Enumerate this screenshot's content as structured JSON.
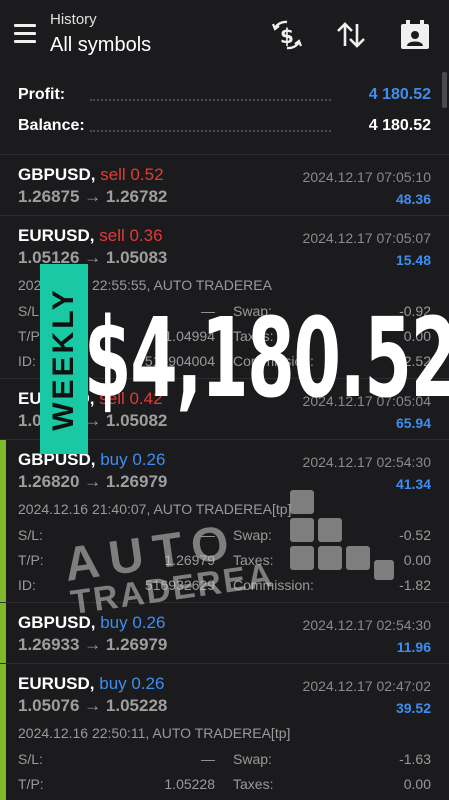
{
  "header": {
    "subtitle": "History",
    "title": "All symbols"
  },
  "summary": [
    {
      "label": "Profit:",
      "value": "4 180.52",
      "color": "#3d8ef0"
    },
    {
      "label": "Balance:",
      "value": "4 180.52",
      "color": "#ffffff"
    }
  ],
  "deals": [
    {
      "symbol": "GBPUSD,",
      "side": "sell 0.52",
      "prices": "1.26875 → 1.26782",
      "time": "2024.12.17 07:05:10",
      "profit": "48.36"
    },
    {
      "symbol": "EURUSD,",
      "side": "sell 0.36",
      "prices": "1.05126 → 1.05083",
      "time": "2024.12.17 07:05:07",
      "profit": "15.48",
      "open_info": "2024.12.16 22:55:55, AUTO TRADEREA",
      "sl_label": "S/L:",
      "sl": "—",
      "swap_label": "Swap:",
      "swap": "-0.92",
      "tp_label": "T/P:",
      "tp": "1.04994",
      "taxes_label": "Taxes:",
      "taxes": "0.00",
      "id_label": "ID:",
      "id": "516904004",
      "commission_label": "Commission:",
      "commission": "-2.52"
    },
    {
      "symbol": "EURUSD,",
      "side": "sell 0.42",
      "prices": "1.05097 → 1.05082",
      "time": "2024.12.17 07:05:04",
      "profit": "65.94"
    },
    {
      "symbol": "GBPUSD,",
      "side": "buy 0.26",
      "prices": "1.26820 → 1.26979",
      "time": "2024.12.17 02:54:30",
      "profit": "41.34",
      "open_info": "2024.12.16 21:40:07, AUTO TRADEREA[tp]",
      "sl_label": "S/L:",
      "sl": "—",
      "swap_label": "Swap:",
      "swap": "-0.52",
      "tp_label": "T/P:",
      "tp": "1.26979",
      "taxes_label": "Taxes:",
      "taxes": "0.00",
      "id_label": "ID:",
      "id": "516932629",
      "commission_label": "Commission:",
      "commission": "-1.82"
    },
    {
      "symbol": "GBPUSD,",
      "side": "buy 0.26",
      "prices": "1.26933 → 1.26979",
      "time": "2024.12.17 02:54:30",
      "profit": "11.96"
    },
    {
      "symbol": "EURUSD,",
      "side": "buy 0.26",
      "prices": "1.05076 → 1.05228",
      "time": "2024.12.17 02:47:02",
      "profit": "39.52",
      "open_info": "2024.12.16 22:50:11, AUTO TRADEREA[tp]",
      "sl_label": "S/L:",
      "sl": "—",
      "swap_label": "Swap:",
      "swap": "-1.63",
      "tp_label": "T/P:",
      "tp": "1.05228",
      "taxes_label": "Taxes:",
      "taxes": "0.00"
    }
  ],
  "overlay": {
    "weekly": "WEEKLY",
    "amount": "$4,180.52",
    "logo_line1": "AUTO",
    "logo_line2": "TRADEREA"
  },
  "colors": {
    "sell": "#e53935",
    "buy": "#3d8ef0",
    "accent_bar": "#7fb82a",
    "weekly_banner": "#18c9a4"
  }
}
